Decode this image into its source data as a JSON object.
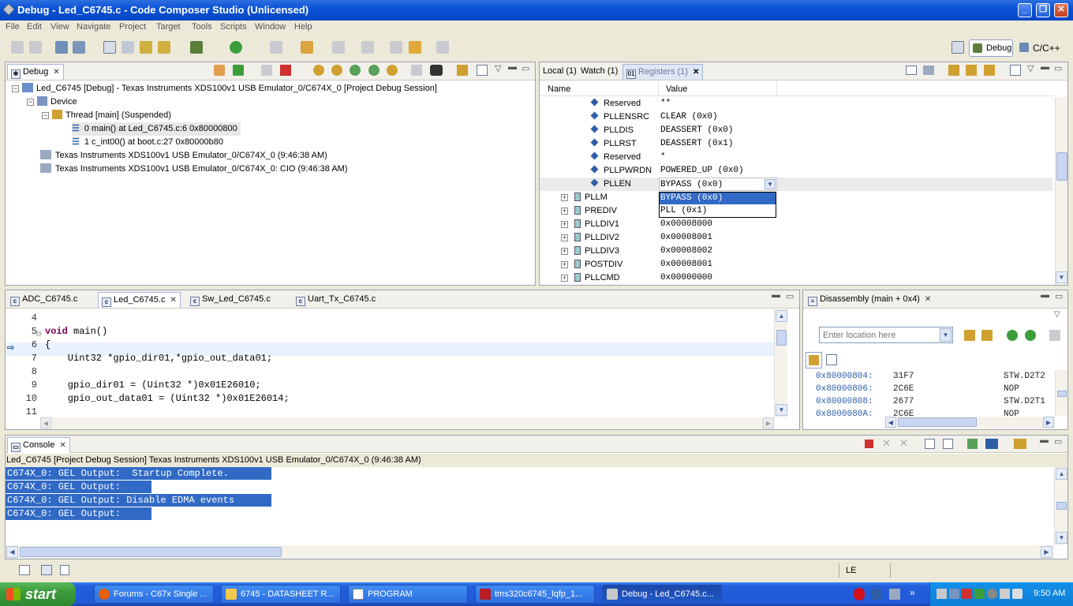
{
  "window": {
    "title": "Debug - Led_C6745.c - Code Composer Studio (Unlicensed)"
  },
  "menu": [
    "File",
    "Edit",
    "View",
    "Navigate",
    "Project",
    "Target",
    "Tools",
    "Scripts",
    "Window",
    "Help"
  ],
  "perspectives": {
    "debug": "Debug",
    "cpp": "C/C++"
  },
  "debug_view": {
    "tab": "Debug",
    "items": [
      "Led_C6745 [Debug] - Texas Instruments XDS100v1 USB Emulator_0/C674X_0 [Project Debug Session]",
      "Device",
      "Thread [main] (Suspended)",
      "0 main() at Led_C6745.c:6 0x80000800",
      "1 c_int00() at boot.c:27 0x80000b80",
      "Texas Instruments XDS100v1 USB Emulator_0/C674X_0 (9:46:38 AM)",
      "Texas Instruments XDS100v1 USB Emulator_0/C674X_0: CIO (9:46:38 AM)"
    ]
  },
  "registers_view": {
    "tabs": [
      "Local (1)",
      "Watch (1)",
      "Registers (1)"
    ],
    "columns": [
      "Name",
      "Value"
    ],
    "rows": [
      {
        "name": "Reserved",
        "value": "**"
      },
      {
        "name": "PLLENSRC",
        "value": "CLEAR (0x0)"
      },
      {
        "name": "PLLDIS",
        "value": "DEASSERT (0x0)"
      },
      {
        "name": "PLLRST",
        "value": "DEASSERT (0x1)"
      },
      {
        "name": "Reserved",
        "value": "*"
      },
      {
        "name": "PLLPWRDN",
        "value": "POWERED_UP (0x0)"
      },
      {
        "name": "PLLEN",
        "value": "BYPASS (0x0)"
      },
      {
        "name": "PLLM",
        "value": ""
      },
      {
        "name": "PREDIV",
        "value": ""
      },
      {
        "name": "PLLDIV1",
        "value": "0x00008000"
      },
      {
        "name": "PLLDIV2",
        "value": "0x00008001"
      },
      {
        "name": "PLLDIV3",
        "value": "0x00008002"
      },
      {
        "name": "POSTDIV",
        "value": "0x00008001"
      },
      {
        "name": "PLLCMD",
        "value": "0x00000000"
      }
    ],
    "dropdown_options": [
      "BYPASS (0x0)",
      "PLL (0x1)"
    ]
  },
  "editor": {
    "tabs": [
      "ADC_C6745.c",
      "Led_C6745.c",
      "Sw_Led_C6745.c",
      "Uart_Tx_C6745.c"
    ],
    "lines": [
      {
        "n": "4",
        "code": ""
      },
      {
        "n": "5",
        "kw": "void",
        "code": " main()"
      },
      {
        "n": "6",
        "code": "{"
      },
      {
        "n": "7",
        "code": "    Uint32 *gpio_dir01,*gpio_out_data01;"
      },
      {
        "n": "8",
        "code": ""
      },
      {
        "n": "9",
        "code": "    gpio_dir01 = (Uint32 *)0x01E26010;"
      },
      {
        "n": "10",
        "code": "    gpio_out_data01 = (Uint32 *)0x01E26014;"
      },
      {
        "n": "11",
        "code": ""
      }
    ]
  },
  "disassembly": {
    "tab": "Disassembly (main + 0x4)",
    "location_placeholder": "Enter location here",
    "rows": [
      {
        "addr": "0x80000804:",
        "op": "31F7",
        "instr": "STW.D2T2"
      },
      {
        "addr": "0x80000806:",
        "op": "2C6E",
        "instr": "NOP"
      },
      {
        "addr": "0x80000808:",
        "op": "2677",
        "instr": "STW.D2T1"
      },
      {
        "addr": "0x8000080A:",
        "op": "2C6E",
        "instr": "NOP"
      }
    ]
  },
  "console": {
    "tab": "Console",
    "header": "Led_C6745 [Project Debug Session] Texas Instruments XDS100v1 USB Emulator_0/C674X_0 (9:46:38 AM)",
    "lines": [
      "C674X_0: GEL Output:  Startup Complete.",
      "C674X_0: GEL Output:",
      "C674X_0: GEL Output: Disable EDMA events",
      "C674X_0: GEL Output:"
    ]
  },
  "statusbar": {
    "mode": "LE"
  },
  "taskbar": {
    "start": "start",
    "buttons": [
      "Forums - C67x Single ...",
      "6745 - DATASHEET R...",
      "PROGRAM",
      "tms320c6745_lqfp_1...",
      "Debug - Led_C6745.c..."
    ],
    "clock": "9:50 AM"
  }
}
